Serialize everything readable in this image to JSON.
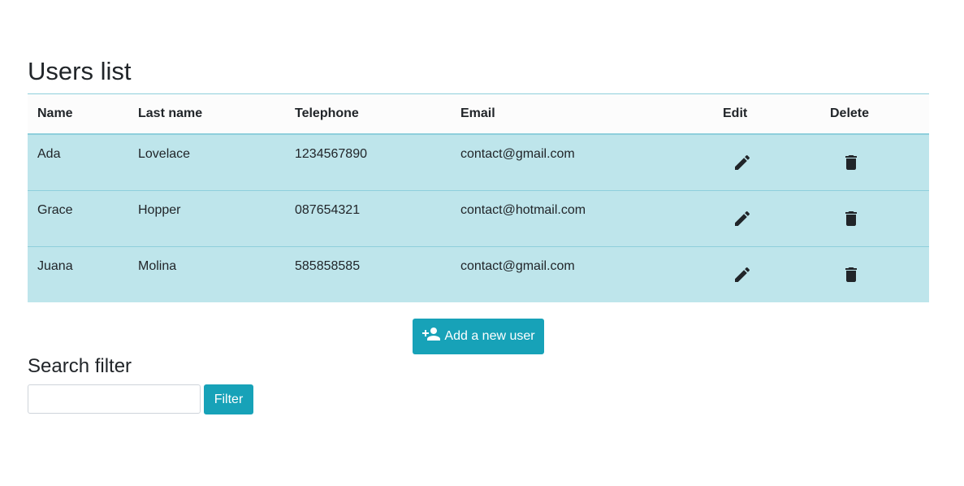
{
  "page": {
    "title": "Users list"
  },
  "table": {
    "headers": {
      "name": "Name",
      "last_name": "Last name",
      "telephone": "Telephone",
      "email": "Email",
      "edit": "Edit",
      "delete": "Delete"
    },
    "rows": [
      {
        "name": "Ada",
        "last_name": "Lovelace",
        "telephone": "1234567890",
        "email": "contact@gmail.com"
      },
      {
        "name": "Grace",
        "last_name": "Hopper",
        "telephone": "087654321",
        "email": "contact@hotmail.com"
      },
      {
        "name": "Juana",
        "last_name": "Molina",
        "telephone": "585858585",
        "email": "contact@gmail.com"
      }
    ]
  },
  "add_user": {
    "label": "Add a new user",
    "icon": "person-add-icon"
  },
  "search": {
    "title": "Search filter",
    "input_value": "",
    "button_label": "Filter"
  },
  "colors": {
    "accent": "#17a2b8",
    "row_bg": "#bee5eb",
    "row_border": "#8fcfdc"
  }
}
